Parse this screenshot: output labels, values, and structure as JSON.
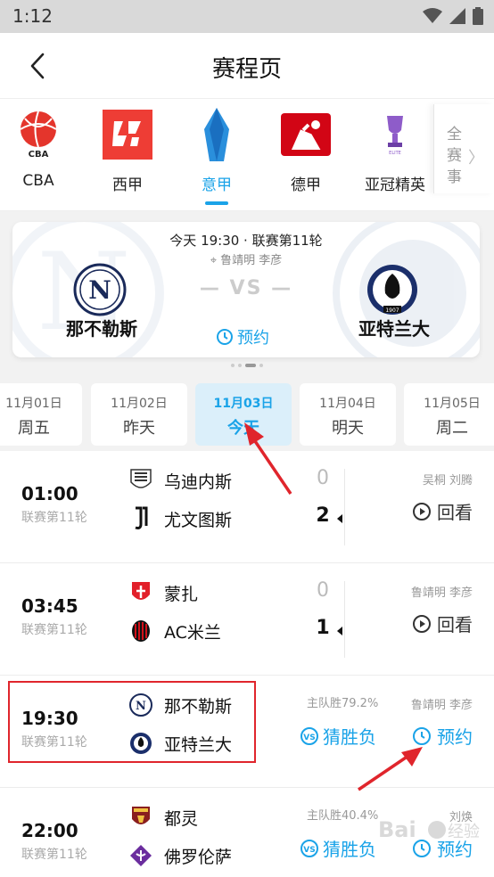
{
  "status": {
    "time": "1:12"
  },
  "header": {
    "title": "赛程页"
  },
  "leagues": [
    {
      "name": "CBA",
      "icon": "cba-logo"
    },
    {
      "name": "西甲",
      "icon": "laliga-logo"
    },
    {
      "name": "意甲",
      "icon": "serie-a-logo"
    },
    {
      "name": "德甲",
      "icon": "bundesliga-logo"
    },
    {
      "name": "亚冠精英",
      "icon": "afc-elite-logo"
    }
  ],
  "all_button": {
    "chars": [
      "全",
      "赛",
      "事"
    ]
  },
  "featured": {
    "meta": "今天 19:30 · 联赛第11轮",
    "refs": "鲁靖明 李彦",
    "vs": "— VS —",
    "home": "那不勒斯",
    "away": "亚特兰大",
    "action": "预约"
  },
  "dates": [
    {
      "date": "11月01日",
      "week": "周五"
    },
    {
      "date": "11月02日",
      "week": "昨天"
    },
    {
      "date": "11月03日",
      "week": "今天"
    },
    {
      "date": "11月04日",
      "week": "明天"
    },
    {
      "date": "11月05日",
      "week": "周二"
    }
  ],
  "matches": [
    {
      "time": "01:00",
      "round": "联赛第11轮",
      "home": "乌迪内斯",
      "away": "尤文图斯",
      "home_score": "0",
      "away_score": "2",
      "refs": "吴桐 刘腾",
      "action": "回看"
    },
    {
      "time": "03:45",
      "round": "联赛第11轮",
      "home": "蒙扎",
      "away": "AC米兰",
      "home_score": "0",
      "away_score": "1",
      "refs": "鲁靖明 李彦",
      "action": "回看"
    },
    {
      "time": "19:30",
      "round": "联赛第11轮",
      "home": "那不勒斯",
      "away": "亚特兰大",
      "guess_rate": "主队胜79.2%",
      "guess": "猜胜负",
      "refs": "鲁靖明 李彦",
      "action": "预约"
    },
    {
      "time": "22:00",
      "round": "联赛第11轮",
      "home": "都灵",
      "away": "佛罗伦萨",
      "guess_rate": "主队胜40.4%",
      "guess": "猜胜负",
      "refs": "刘焕",
      "action": "预约"
    }
  ],
  "colors": {
    "accent": "#1aa3e8",
    "highlight": "#e0252c"
  },
  "watermark": "Baidu 经验"
}
